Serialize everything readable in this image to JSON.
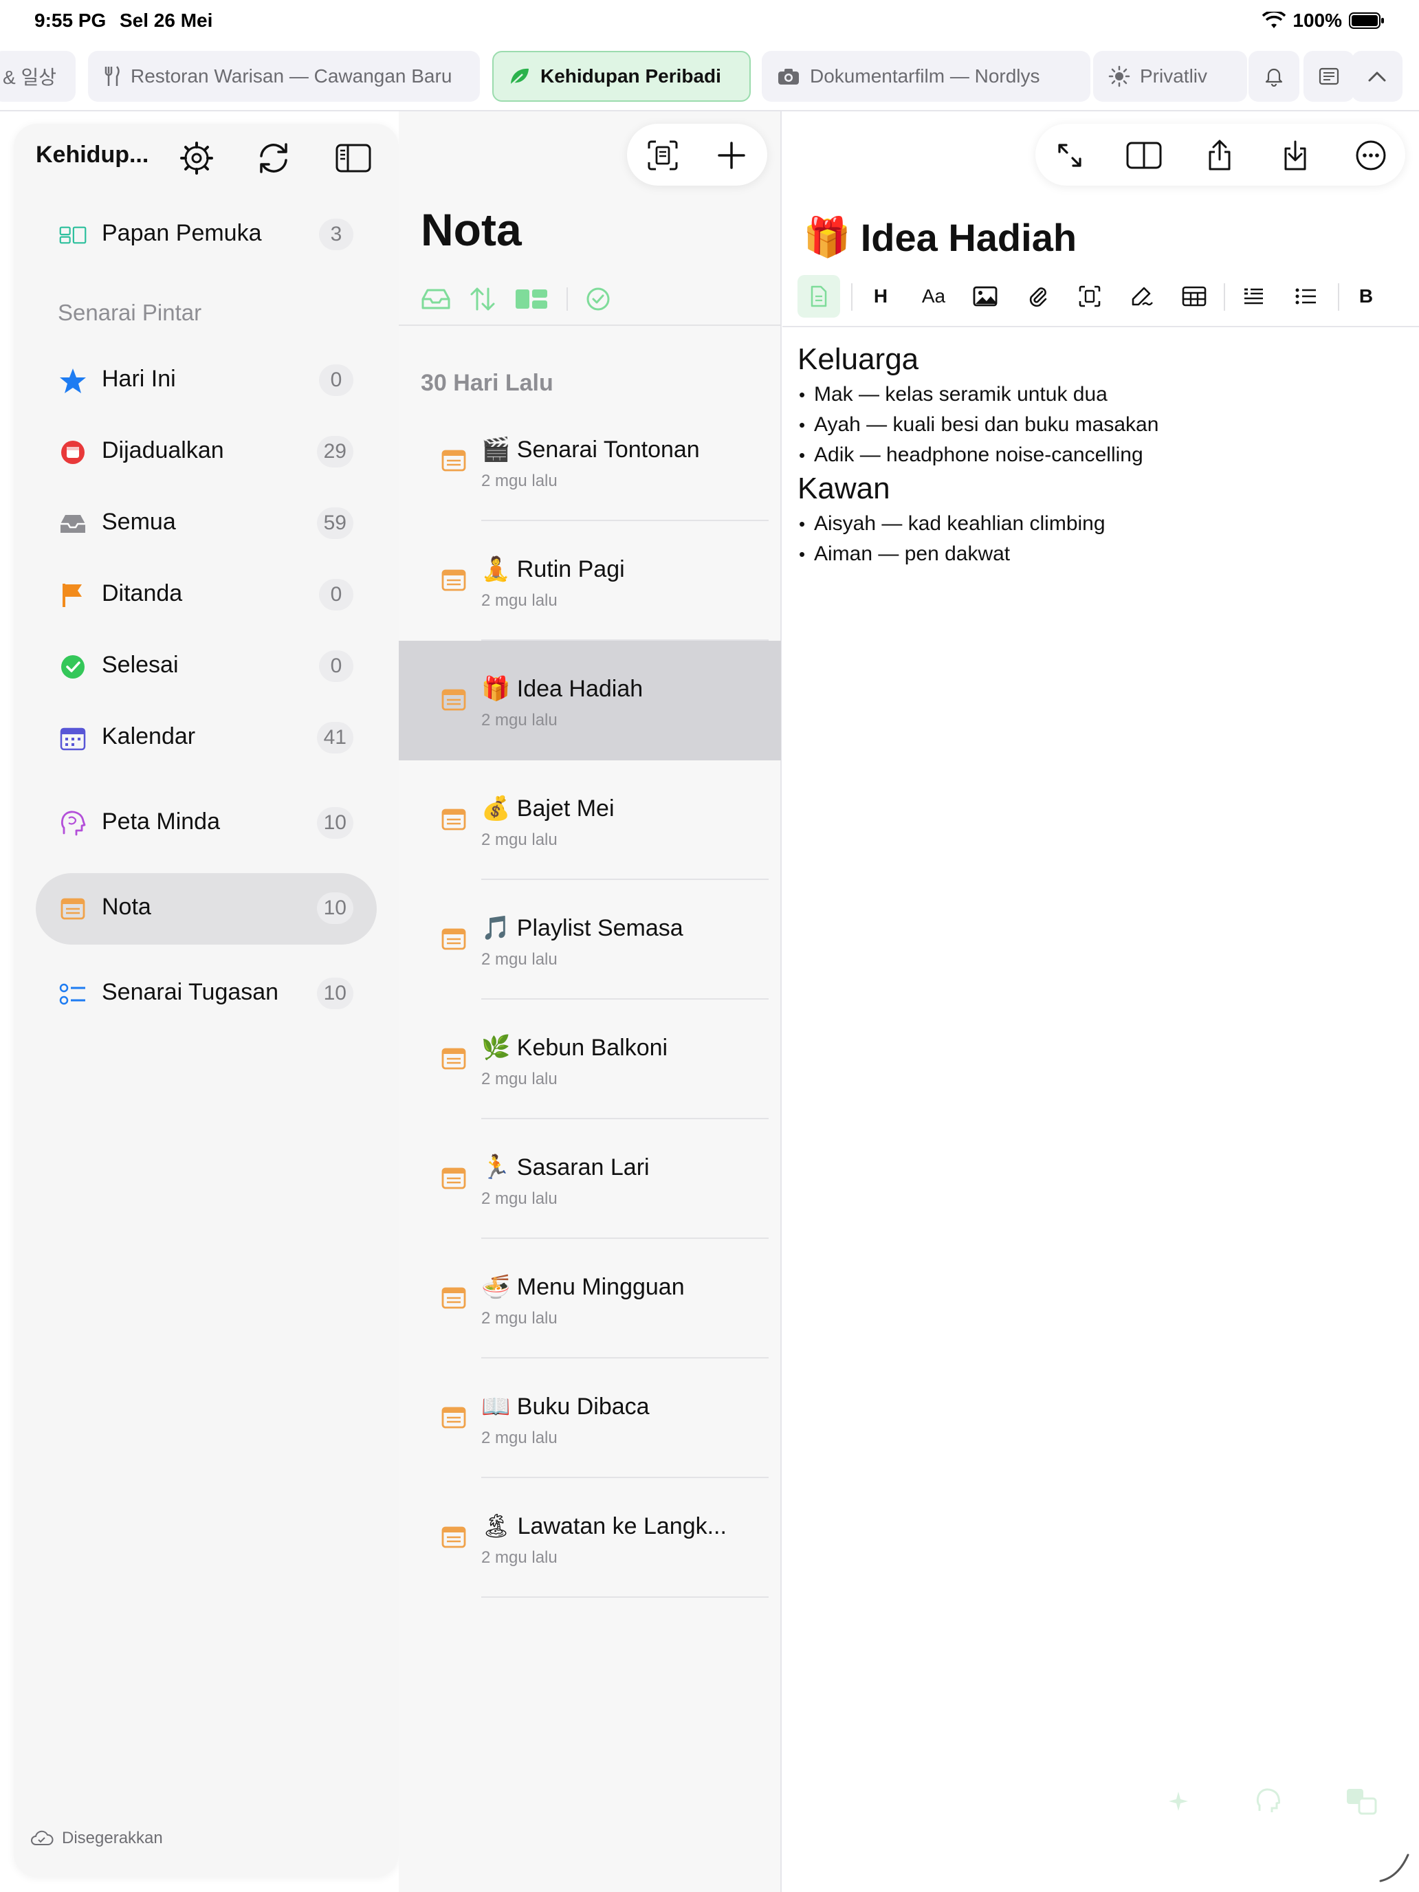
{
  "status": {
    "time": "9:55 PG",
    "date": "Sel 26 Mei",
    "battery": "100%"
  },
  "tabs": [
    {
      "label": "& 일상",
      "icon": "none"
    },
    {
      "label": "Restoran Warisan — Cawangan Baru",
      "icon": "fork-knife-icon"
    },
    {
      "label": "Kehidupan Peribadi",
      "icon": "leaf-icon",
      "active": true
    },
    {
      "label": "Dokumentarfilm — Nordlys",
      "icon": "camera-icon"
    },
    {
      "label": "Privatliv",
      "icon": "sun-icon"
    }
  ],
  "sidebar": {
    "title": "Kehidup...",
    "dashboard": {
      "label": "Papan Pemuka",
      "count": "3"
    },
    "smart_section": "Senarai Pintar",
    "items": [
      {
        "label": "Hari Ini",
        "count": "0"
      },
      {
        "label": "Dijadualkan",
        "count": "29"
      },
      {
        "label": "Semua",
        "count": "59"
      },
      {
        "label": "Ditanda",
        "count": "0"
      },
      {
        "label": "Selesai",
        "count": "0"
      },
      {
        "label": "Kalendar",
        "count": "41"
      },
      {
        "label": "Peta Minda",
        "count": "10"
      },
      {
        "label": "Nota",
        "count": "10",
        "selected": true
      },
      {
        "label": "Senarai Tugasan",
        "count": "10"
      }
    ],
    "footer": "Disegerakkan"
  },
  "list": {
    "title": "Nota",
    "group": "30 Hari Lalu",
    "notes": [
      {
        "emoji": "🎬",
        "title": "Senarai Tontonan",
        "date": "2 mgu lalu"
      },
      {
        "emoji": "🧘",
        "title": "Rutin Pagi",
        "date": "2 mgu lalu"
      },
      {
        "emoji": "🎁",
        "title": "Idea Hadiah",
        "date": "2 mgu lalu",
        "selected": true
      },
      {
        "emoji": "💰",
        "title": "Bajet Mei",
        "date": "2 mgu lalu"
      },
      {
        "emoji": "🎵",
        "title": "Playlist Semasa",
        "date": "2 mgu lalu"
      },
      {
        "emoji": "🌿",
        "title": "Kebun Balkoni",
        "date": "2 mgu lalu"
      },
      {
        "emoji": "🏃",
        "title": "Sasaran Lari",
        "date": "2 mgu lalu"
      },
      {
        "emoji": "🍜",
        "title": "Menu Mingguan",
        "date": "2 mgu lalu"
      },
      {
        "emoji": "📖",
        "title": "Buku Dibaca",
        "date": "2 mgu lalu"
      },
      {
        "emoji": "🏝",
        "title": "Lawatan ke Langk...",
        "date": "2 mgu lalu"
      }
    ]
  },
  "editor": {
    "title_emoji": "🎁",
    "title": "Idea Hadiah",
    "format": {
      "heading": "H",
      "text": "Aa",
      "bold": "B"
    },
    "sections": [
      {
        "heading": "Keluarga",
        "items": [
          "Mak — kelas seramik untuk dua",
          "Ayah — kuali besi dan buku masakan",
          "Adik — headphone noise-cancelling"
        ]
      },
      {
        "heading": "Kawan",
        "items": [
          "Aisyah — kad keahlian climbing",
          "Aiman — pen dakwat"
        ]
      }
    ]
  },
  "colors": {
    "accent_green": "#34c759",
    "note_orange": "#f0a24a",
    "selected_gray": "#d4d4d8"
  }
}
